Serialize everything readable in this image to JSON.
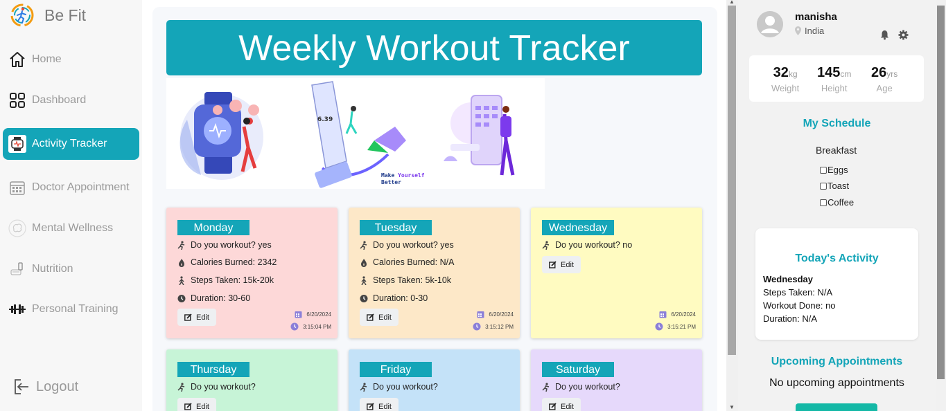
{
  "sidebar": {
    "brand": "Be Fit",
    "items": [
      {
        "label": "Home",
        "icon": "home-icon"
      },
      {
        "label": "Dashboard",
        "icon": "grid-icon"
      },
      {
        "label": "Activity Tracker",
        "icon": "smartwatch-icon"
      },
      {
        "label": "Doctor Appointment",
        "icon": "calendar-icon"
      },
      {
        "label": "Mental Wellness",
        "icon": "brain-icon"
      },
      {
        "label": "Nutrition",
        "icon": "nutrition-icon"
      },
      {
        "label": "Personal Training",
        "icon": "dumbbell-icon"
      }
    ],
    "logout": "Logout"
  },
  "main": {
    "title": "Weekly Workout Tracker",
    "illustration_caption": [
      "Make ",
      "Yourself",
      "Better"
    ],
    "watch_reading": "6.39",
    "days": [
      {
        "name": "Monday",
        "color": "#fdd8d8",
        "workout": "Do you workout?  yes",
        "calories": "Calories Burned: 2342",
        "steps": "Steps Taken: 15k-20k",
        "duration": "Duration: 30-60",
        "date": "6/20/2024",
        "time": "3:15:04 PM"
      },
      {
        "name": "Tuesday",
        "color": "#fde8c8",
        "workout": "Do you workout?  yes",
        "calories": "Calories Burned: N/A",
        "steps": "Steps Taken: 5k-10k",
        "duration": "Duration: 0-30",
        "date": "6/20/2024",
        "time": "3:15:12 PM"
      },
      {
        "name": "Wednesday",
        "color": "#fffbc1",
        "workout": "Do you workout?  no",
        "date": "6/20/2024",
        "time": "3:15:21 PM"
      },
      {
        "name": "Thursday",
        "color": "#c7f4d7",
        "workout": "Do you workout?"
      },
      {
        "name": "Friday",
        "color": "#c4e2f8",
        "workout": "Do you workout?"
      },
      {
        "name": "Saturday",
        "color": "#e6d9fb",
        "workout": "Do you workout?"
      }
    ],
    "edit_label": "Edit"
  },
  "profile": {
    "name": "manisha",
    "location": "India",
    "weight": {
      "value": "32",
      "unit": "kg",
      "label": "Weight"
    },
    "height": {
      "value": "145",
      "unit": "cm",
      "label": "Height"
    },
    "age": {
      "value": "26",
      "unit": "yrs",
      "label": "Age"
    }
  },
  "schedule": {
    "title": "My Schedule",
    "meal": "Breakfast",
    "items": [
      "Eggs",
      "Toast",
      "Coffee"
    ]
  },
  "activity": {
    "title": "Today's Activity",
    "day": "Wednesday",
    "steps": "Steps Taken: N/A",
    "workout": "Workout Done: no",
    "duration": "Duration: N/A"
  },
  "appointments": {
    "title": "Upcoming Appointments",
    "empty": "No upcoming appointments"
  },
  "colors": {
    "accent": "#14a5b8"
  }
}
